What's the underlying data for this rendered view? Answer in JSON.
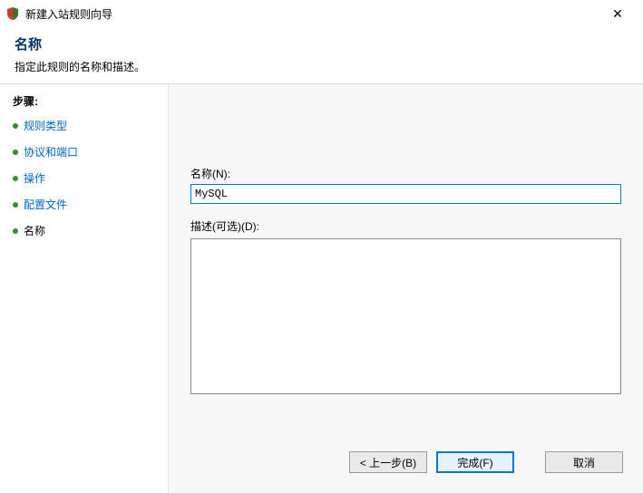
{
  "window": {
    "title": "新建入站规则向导",
    "close_glyph": "✕"
  },
  "header": {
    "title": "名称",
    "subtitle": "指定此规则的名称和描述。"
  },
  "sidebar": {
    "steps_label": "步骤:",
    "items": [
      {
        "label": "规则类型",
        "active": false
      },
      {
        "label": "协议和端口",
        "active": false
      },
      {
        "label": "操作",
        "active": false
      },
      {
        "label": "配置文件",
        "active": false
      },
      {
        "label": "名称",
        "active": true
      }
    ]
  },
  "form": {
    "name_label": "名称(N):",
    "name_value": "MySQL",
    "desc_label": "描述(可选)(D):",
    "desc_value": ""
  },
  "buttons": {
    "back": "< 上一步(B)",
    "finish": "完成(F)",
    "cancel": "取消"
  }
}
